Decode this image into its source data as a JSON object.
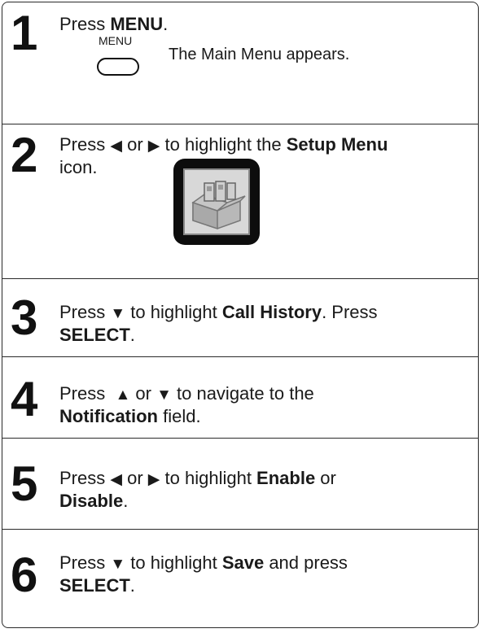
{
  "steps": [
    {
      "number": "1",
      "line1_pre": "Press ",
      "line1_bold": "MENU",
      "line1_post": ".",
      "key_label": "MENU",
      "result": "The Main Menu appears."
    },
    {
      "number": "2",
      "pre": "Press ",
      "left_arrow": "◀",
      "or": " or ",
      "right_arrow": "▶",
      "mid": " to highlight the ",
      "bold": "Setup Menu",
      "line2": "icon.",
      "icon_name": "setup-menu-icon"
    },
    {
      "number": "3",
      "pre": "Press ",
      "down_arrow": "▼",
      "mid": " to highlight ",
      "bold": "Call History",
      "post": ". Press",
      "line2_bold": "SELECT",
      "line2_post": "."
    },
    {
      "number": "4",
      "pre": "Press  ",
      "up_arrow": "▲",
      "or": " or ",
      "down_arrow": "▼",
      "mid": " to navigate to the",
      "line2_bold": "Notification",
      "line2_post": " field."
    },
    {
      "number": "5",
      "pre": "Press ",
      "left_arrow": "◀",
      "or": " or ",
      "right_arrow": "▶",
      "mid": " to highlight ",
      "bold": "Enable",
      "post": " or",
      "line2_bold": "Disable",
      "line2_post": "."
    },
    {
      "number": "6",
      "pre": "Press ",
      "down_arrow": "▼",
      "mid": " to highlight ",
      "bold": "Save",
      "post": " and press",
      "line2_bold": "SELECT",
      "line2_post": "."
    }
  ]
}
